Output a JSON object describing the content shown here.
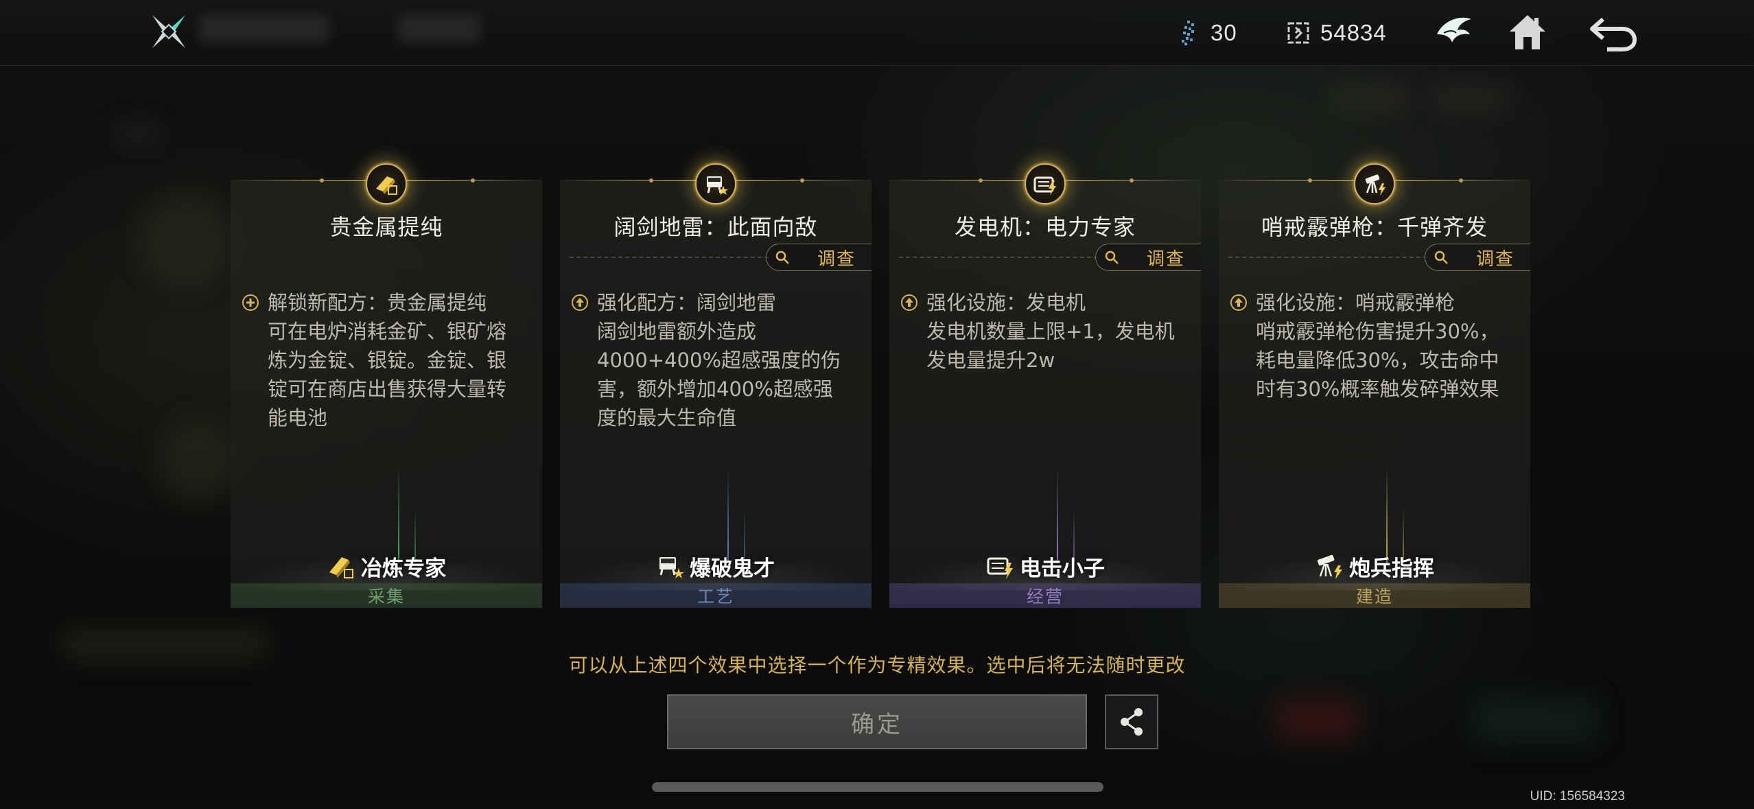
{
  "topbar": {
    "resources": [
      {
        "icon": "energy-crystal-icon",
        "value": "30"
      },
      {
        "icon": "gear-currency-icon",
        "value": "54834"
      }
    ],
    "buttons": [
      "faction-emblem-icon",
      "home-icon",
      "back-icon"
    ]
  },
  "cards": [
    {
      "title": "贵金属提纯",
      "has_investigate": false,
      "effect_type_icon": "plus-circle-icon",
      "effect_head": "解锁新配方：贵金属提纯",
      "effect_body": "可在电炉消耗金矿、银矿熔炼为金锭、银锭。金锭、银锭可在商店出售获得大量转能电池",
      "specialist": "冶炼专家",
      "specialist_icon": "gold-bar-icon",
      "category": "采集",
      "category_color": "#5f8a5a"
    },
    {
      "title": "阔剑地雷：此面向敌",
      "has_investigate": true,
      "investigate_label": "调查",
      "effect_type_icon": "upgrade-arrow-icon",
      "effect_head": "强化配方：阔剑地雷",
      "effect_body": "阔剑地雷额外造成4000+400%超感强度的伤害，额外增加400%超感强度的最大生命值",
      "specialist": "爆破鬼才",
      "specialist_icon": "explosive-icon",
      "category": "工艺",
      "category_color": "#5a6f96"
    },
    {
      "title": "发电机：电力专家",
      "has_investigate": true,
      "investigate_label": "调查",
      "effect_type_icon": "upgrade-arrow-icon",
      "effect_head": "强化设施：发电机",
      "effect_body": "发电机数量上限+1，发电机发电量提升2w",
      "specialist": "电击小子",
      "specialist_icon": "generator-icon",
      "category": "经营",
      "category_color": "#7a6aa6"
    },
    {
      "title": "哨戒霰弹枪：千弹齐发",
      "has_investigate": true,
      "investigate_label": "调查",
      "effect_type_icon": "upgrade-arrow-icon",
      "effect_head": "强化设施：哨戒霰弹枪",
      "effect_body": "哨戒霰弹枪伤害提升30%，耗电量降低30%，攻击命中时有30%概率触发碎弹效果",
      "specialist": "炮兵指挥",
      "specialist_icon": "turret-icon",
      "category": "建造",
      "category_color": "#a8934f"
    }
  ],
  "footer": {
    "hint": "可以从上述四个效果中选择一个作为专精效果。选中后将无法随时更改",
    "confirm_label": "确定",
    "uid": "UID: 156584323"
  },
  "colors": {
    "gold_accent": "#d9b552",
    "panel_bg": "#1e201c"
  }
}
